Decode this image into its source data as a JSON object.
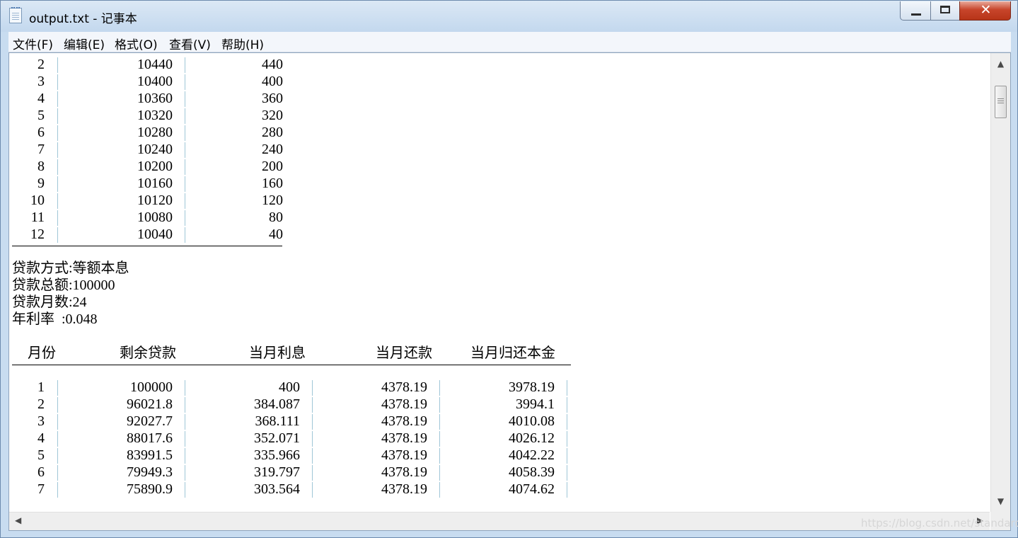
{
  "window": {
    "title": "output.txt - 记事本",
    "close_glyph": "✕"
  },
  "menu": {
    "items": [
      "文件(F)",
      "编辑(E)",
      "格式(O)",
      "查看(V)",
      "帮助(H)"
    ]
  },
  "content": {
    "table1_rows": [
      [
        "2",
        "10440",
        "440"
      ],
      [
        "3",
        "10400",
        "400"
      ],
      [
        "4",
        "10360",
        "360"
      ],
      [
        "5",
        "10320",
        "320"
      ],
      [
        "6",
        "10280",
        "280"
      ],
      [
        "7",
        "10240",
        "240"
      ],
      [
        "8",
        "10200",
        "200"
      ],
      [
        "9",
        "10160",
        "160"
      ],
      [
        "10",
        "10120",
        "120"
      ],
      [
        "11",
        "10080",
        "80"
      ],
      [
        "12",
        "10040",
        "40"
      ]
    ],
    "loan_info": [
      "贷款方式:等额本息",
      "贷款总额:100000",
      "贷款月数:24",
      "年利率  :0.048"
    ],
    "table2_headers": [
      "月份",
      "剩余贷款",
      "当月利息",
      "当月还款",
      "当月归还本金"
    ],
    "table2_rows": [
      [
        "1",
        "100000",
        "400",
        "4378.19",
        "3978.19"
      ],
      [
        "2",
        "96021.8",
        "384.087",
        "4378.19",
        "3994.1"
      ],
      [
        "3",
        "92027.7",
        "368.111",
        "4378.19",
        "4010.08"
      ],
      [
        "4",
        "88017.6",
        "352.071",
        "4378.19",
        "4026.12"
      ],
      [
        "5",
        "83991.5",
        "335.966",
        "4378.19",
        "4042.22"
      ],
      [
        "6",
        "79949.3",
        "319.797",
        "4378.19",
        "4058.39"
      ],
      [
        "7",
        "75890.9",
        "303.564",
        "4378.19",
        "4074.62"
      ]
    ]
  },
  "scrollbars": {
    "up_arrow": "▲",
    "down_arrow": "▼",
    "left_arrow": "◀",
    "right_arrow": "▶"
  },
  "watermark": "https://blog.csdn.net/standard"
}
